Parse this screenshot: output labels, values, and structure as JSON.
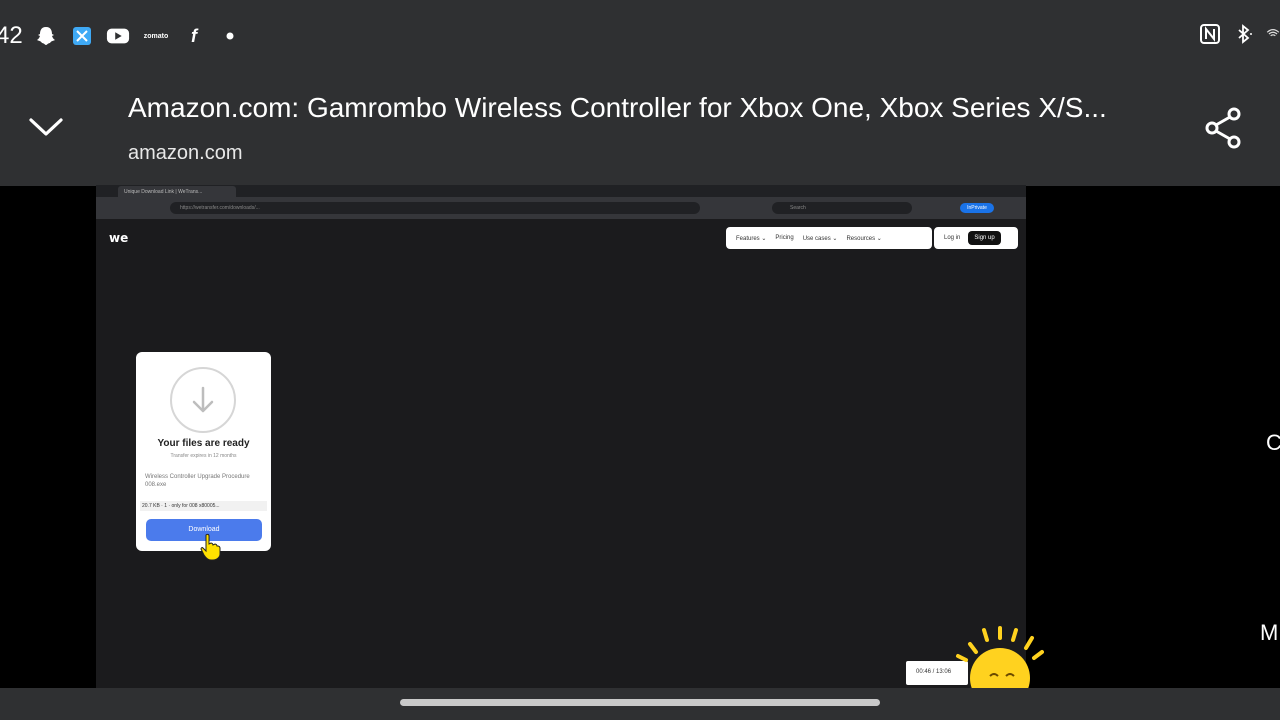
{
  "statusbar": {
    "time_fragment": "42",
    "left_icons": [
      "snapchat-icon",
      "app-icon",
      "youtube-icon",
      "zomato-icon",
      "facebook-icon",
      "dot-icon"
    ],
    "zomato_label": "zomato",
    "right_icons": [
      "nfc-icon",
      "bluetooth-icon",
      "wifi-icon"
    ]
  },
  "header": {
    "title": "Amazon.com: Gamrombo Wireless Controller for Xbox One, Xbox Series X/S...",
    "domain": "amazon.com"
  },
  "video": {
    "tab_label": "Unique Download Link | WeTrans...",
    "url": "https://wetransfer.com/downloads/...",
    "search_placeholder": "Search",
    "signin_label": "InPrivate",
    "logo": "we",
    "nav": {
      "features": "Features ⌄",
      "pricing": "Pricing",
      "use_cases": "Use cases ⌄",
      "resources": "Resources ⌄",
      "login": "Log in",
      "signup": "Sign up"
    },
    "card": {
      "title": "Your files are ready",
      "expires": "Transfer expires in 12 months",
      "filename": "Wireless Controller Upgrade Procedure 008.exe",
      "size_text": "20.7 KB · 1 · only for 008 x80005...",
      "download": "Download"
    },
    "time_badge": "00:46 / 13:06"
  },
  "edge": {
    "letter_c": "C",
    "letter_m": "M"
  }
}
